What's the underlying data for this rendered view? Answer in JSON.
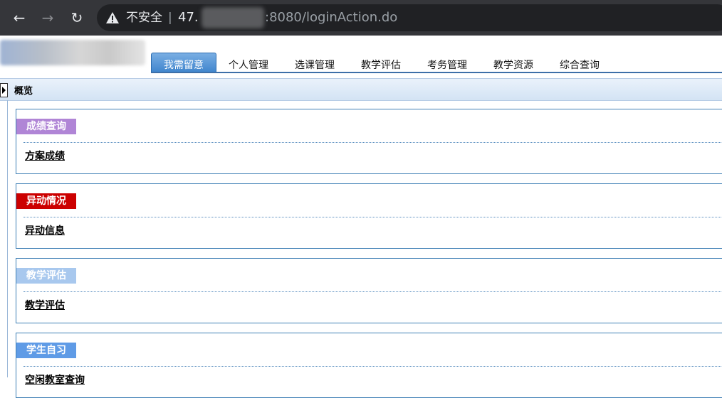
{
  "browser": {
    "security_label": "不安全",
    "separator": "|",
    "host_prefix": "47.",
    "url_suffix": ":8080/loginAction.do"
  },
  "nav": {
    "tabs": [
      {
        "label": "我需留意",
        "active": true
      },
      {
        "label": "个人管理"
      },
      {
        "label": "选课管理"
      },
      {
        "label": "教学评估"
      },
      {
        "label": "考务管理"
      },
      {
        "label": "教学资源"
      },
      {
        "label": "综合查询"
      }
    ]
  },
  "section": {
    "title": "概览"
  },
  "cards": [
    {
      "label": "成绩查询",
      "color": "#b085d6",
      "link": "方案成绩"
    },
    {
      "label": "异动情况",
      "color": "#cc0000",
      "link": "异动信息"
    },
    {
      "label": "教学评估",
      "color": "#a8c8ee",
      "link": "教学评估"
    },
    {
      "label": "学生自习",
      "color": "#5f9be6",
      "link": "空闲教室查询"
    }
  ]
}
